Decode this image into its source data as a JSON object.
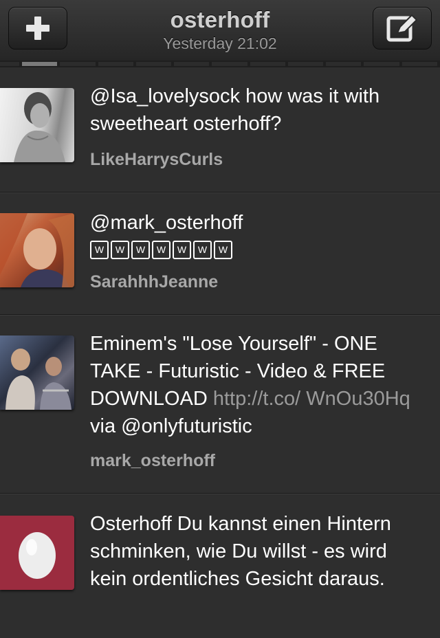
{
  "header": {
    "title": "osterhoff",
    "subtitle": "Yesterday 21:02",
    "add_icon": "plus-icon",
    "compose_icon": "compose-icon"
  },
  "tweets": [
    {
      "text": "@Isa_lovelysock how was it with sweetheart osterhoff?",
      "user": "LikeHarrysCurls"
    },
    {
      "text": "@mark_osterhoff",
      "emoji_boxes": [
        "W",
        "W",
        "W",
        "W",
        "W",
        "W",
        "W"
      ],
      "user": "SarahhhJeanne"
    },
    {
      "text_before": "Eminem's \"Lose Yourself\" - ONE TAKE - Futuristic - Video & FREE DOWNLOAD",
      "link": "http://t.co/ WnOu30Hq",
      "text_after": "via @onlyfuturistic",
      "user": "mark_osterhoff"
    },
    {
      "text": "Osterhoff  Du kannst einen Hintern schminken, wie Du willst - es wird kein ordentliches Gesicht daraus.",
      "user": ""
    }
  ],
  "colors": {
    "background": "#2e2e2e",
    "username": "#a8a8a8",
    "link": "#9b9b9b",
    "egg_avatar_bg": "#9b2c3f"
  }
}
